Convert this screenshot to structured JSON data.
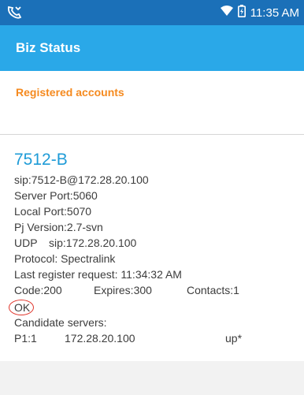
{
  "status_bar": {
    "time": "11:35 AM"
  },
  "app_bar": {
    "title": "Biz Status"
  },
  "section": {
    "title": "Registered accounts"
  },
  "account": {
    "name": "7512-B",
    "sip_uri": "sip:7512-B@172.28.20.100",
    "server_port": "Server Port:5060",
    "local_port": "Local Port:5070",
    "pj_version": "Pj Version:2.7-svn",
    "transport": "UDP",
    "transport_addr": "sip:172.28.20.100",
    "protocol": "Protocol: Spectralink",
    "last_register": "Last register request: 11:34:32 AM",
    "code": "Code:200",
    "expires": "Expires:300",
    "contacts": "Contacts:1",
    "status": "OK",
    "candidate_label": "Candidate servers:",
    "candidate": {
      "priority": "P1:1",
      "address": "172.28.20.100",
      "state": "up*"
    }
  },
  "colors": {
    "status_bar": "#1b70b8",
    "app_bar": "#2aa8e8",
    "section_title": "#f58a1f",
    "account_name": "#1e9bd7",
    "ok_circle": "#e0362c"
  }
}
